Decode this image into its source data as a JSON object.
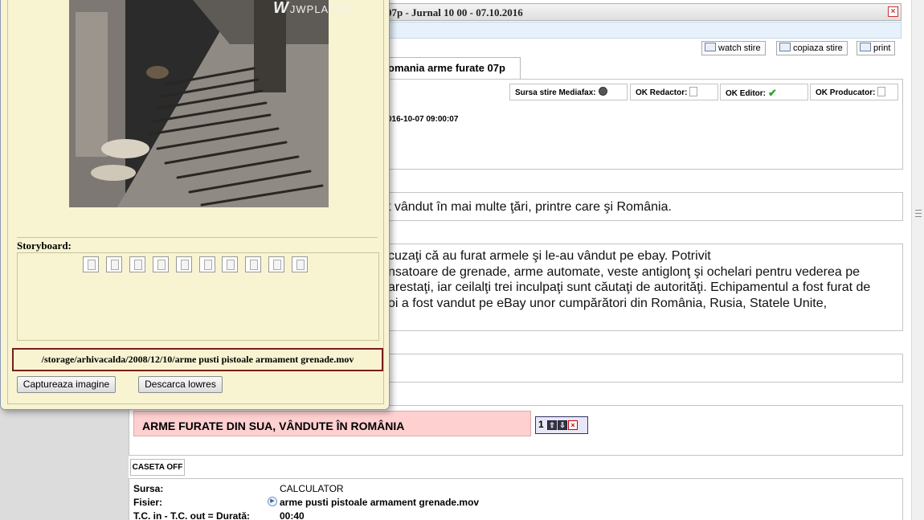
{
  "window": {
    "title": "07p - Jurnal 10 00 - 07.10.2016",
    "close_glyph": "×"
  },
  "toolbar": {
    "watch_label": "watch stire",
    "copy_label": "copiaza stire",
    "print_label": "print"
  },
  "tab": {
    "label": "omania arme furate 07p"
  },
  "status": {
    "source_label": "Sursa stire Mediafax:",
    "redactor_label": "OK Redactor:",
    "editor_label": "OK Editor:",
    "producer_label": "OK Producator:",
    "check_glyph": "✔"
  },
  "news": {
    "datetime": "016-10-07 09:00:07",
    "lead": "t vândut în mai multe ţări, printre care şi România.",
    "body_lines": [
      "cuzaţi că au furat armele şi le-au vândut pe ebay. Potrivit",
      "nsatoare de grenade, arme automate, veste antiglonţ şi ochelari pentru vederea pe",
      "arestaţi, iar ceilalţi trei inculpaţi sunt căutaţi de autorităţi. Echipamentul a fost furat de",
      "oi a fost vandut pe eBay unor cumpărători din România, Rusia, Statele Unite,"
    ],
    "headline": "ARME FURATE DIN SUA, VÂNDUTE ÎN ROMÂNIA",
    "headline_order": "1",
    "up_glyph": "⇧",
    "down_glyph": "⇩",
    "remove_glyph": "×"
  },
  "caseta": {
    "label": "CASETA OFF"
  },
  "info": {
    "source_label": "Sursa:",
    "source_value": "CALCULATOR",
    "file_label": "Fisier:",
    "file_value": "arme pusti pistoale armament grenade.mov",
    "tc_label": "T.C. in - T.C. out = Durată:",
    "tc_value": "00:40",
    "play_glyph": "▶"
  },
  "player": {
    "brand": "JWPLAYER",
    "brand_mark": "W",
    "storyboard_label": "Storyboard:",
    "thumbnail_count": 10,
    "file_path": "/storage/arhivacalda/2008/12/10/arme pusti pistoale armament grenade.mov",
    "capture_label": "Captureaza imagine",
    "download_label": "Descarca lowres"
  },
  "colors": {
    "headline_bg": "#ffd0d0",
    "player_bg": "#f8f4d2",
    "path_border": "#7a1c1c",
    "ok_check": "#2aa52a"
  }
}
